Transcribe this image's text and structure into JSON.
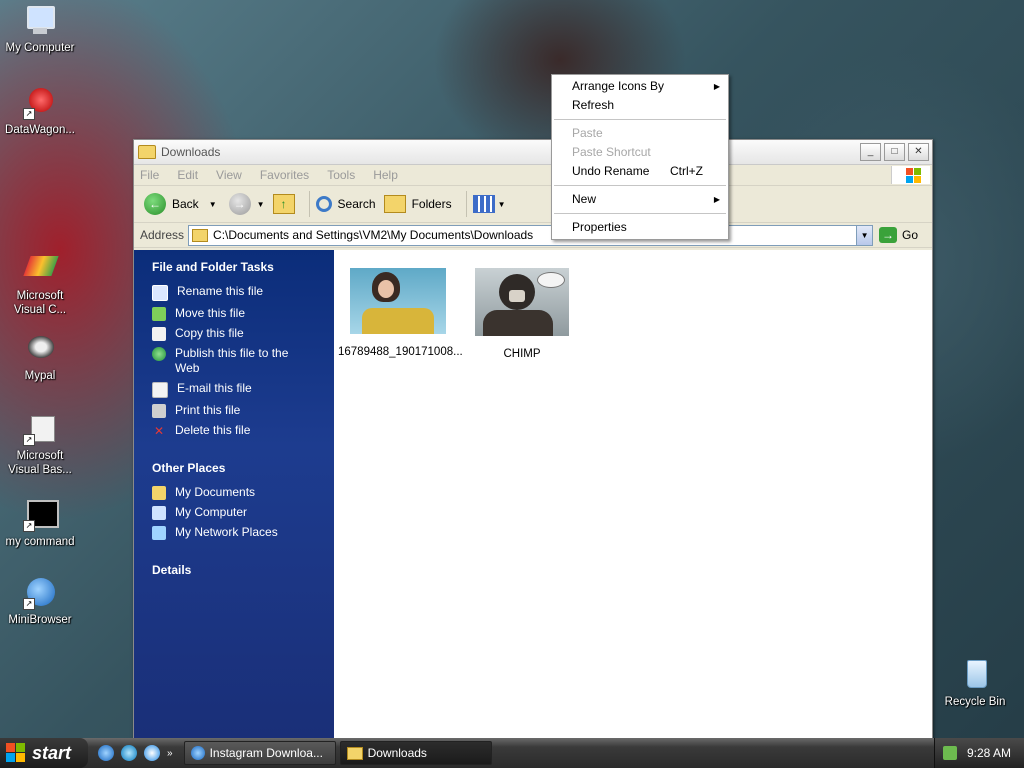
{
  "desktop": {
    "icons": [
      {
        "label": "My Computer"
      },
      {
        "label": "DataWagon..."
      },
      {
        "label": "Microsoft Visual C..."
      },
      {
        "label": "Mypal"
      },
      {
        "label": "Microsoft Visual Bas..."
      },
      {
        "label": "my command"
      },
      {
        "label": "MiniBrowser"
      },
      {
        "label": "Recycle Bin"
      }
    ]
  },
  "window": {
    "title": "Downloads",
    "menu": [
      "File",
      "Edit",
      "View",
      "Favorites",
      "Tools",
      "Help"
    ],
    "toolbar": {
      "back": "Back",
      "search": "Search",
      "folders": "Folders"
    },
    "address": {
      "label": "Address",
      "value": "C:\\Documents and Settings\\VM2\\My Documents\\Downloads",
      "go": "Go"
    },
    "taskpane": {
      "file_tasks_title": "File and Folder Tasks",
      "file_tasks": [
        "Rename this file",
        "Move this file",
        "Copy this file",
        "Publish this file to the Web",
        "E-mail this file",
        "Print this file",
        "Delete this file"
      ],
      "other_places_title": "Other Places",
      "other_places": [
        "My Documents",
        "My Computer",
        "My Network Places"
      ],
      "details_title": "Details"
    },
    "files": [
      {
        "name": "16789488_190171008..."
      },
      {
        "name": "CHIMP"
      }
    ]
  },
  "context_menu": {
    "items": [
      {
        "label": "Arrange Icons By",
        "submenu": true
      },
      {
        "label": "Refresh"
      },
      {
        "label": "Paste",
        "disabled": true
      },
      {
        "label": "Paste Shortcut",
        "disabled": true
      },
      {
        "label": "Undo Rename",
        "shortcut": "Ctrl+Z"
      },
      {
        "label": "New",
        "submenu": true
      },
      {
        "label": "Properties"
      }
    ]
  },
  "taskbar": {
    "start": "start",
    "tasks": [
      {
        "label": "Instagram Downloa..."
      },
      {
        "label": "Downloads"
      }
    ],
    "clock": "9:28 AM"
  }
}
